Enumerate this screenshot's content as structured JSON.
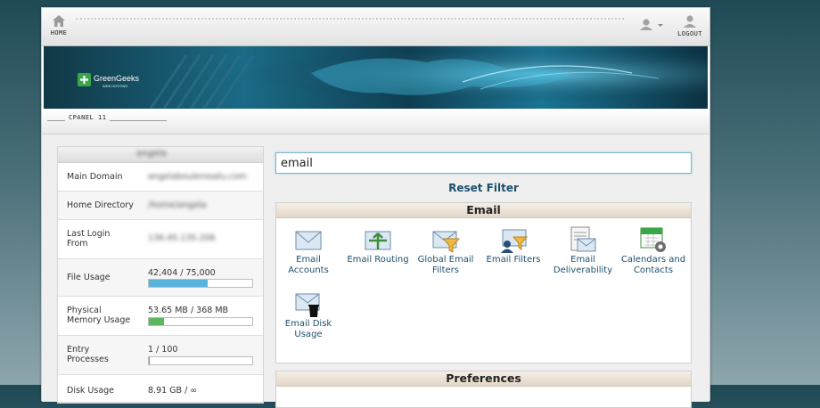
{
  "header": {
    "home_label": "HOME",
    "logout_label": "LOGOUT"
  },
  "banner": {
    "brand": "GreenGeeks",
    "brand_sub": "WEB HOSTING"
  },
  "cpanel_version": "CPANEL 11",
  "stats": {
    "username": "angela",
    "rows": [
      {
        "label": "Main Domain",
        "value": "angelaboulerosalu.com"
      },
      {
        "label": "Home Directory",
        "value": "/home/angela"
      },
      {
        "label": "Last Login From",
        "value": "136.45.135.206"
      },
      {
        "label": "File Usage",
        "value": "42,404 / 75,000",
        "fraction": 0.565
      },
      {
        "label": "Physical Memory Usage",
        "value": "53.65 MB / 368 MB",
        "fraction": 0.146
      },
      {
        "label": "Entry Processes",
        "value": "1 / 100",
        "fraction": 0.01
      },
      {
        "label": "Disk Usage",
        "value": "8.91 GB / ∞"
      }
    ]
  },
  "search": {
    "value": "email"
  },
  "reset_filter": "Reset Filter",
  "email_group": {
    "title": "Email",
    "items": [
      {
        "label": "Email Accounts",
        "icon": "email-accounts-icon"
      },
      {
        "label": "Email Routing",
        "icon": "email-routing-icon"
      },
      {
        "label": "Global Email Filters",
        "icon": "global-email-filters-icon"
      },
      {
        "label": "Email Filters",
        "icon": "email-filters-icon"
      },
      {
        "label": "Email Deliverability",
        "icon": "email-deliverability-icon"
      },
      {
        "label": "Calendars and Contacts",
        "icon": "calendars-contacts-icon"
      },
      {
        "label": "Email Disk Usage",
        "icon": "email-disk-usage-icon"
      }
    ]
  },
  "preferences_group": {
    "title": "Preferences"
  },
  "colors": {
    "accent_link": "#1d4f6e",
    "file_bar": "#56b4dd",
    "memory_bar": "#5cb85c",
    "process_bar": "#5cb85c"
  }
}
